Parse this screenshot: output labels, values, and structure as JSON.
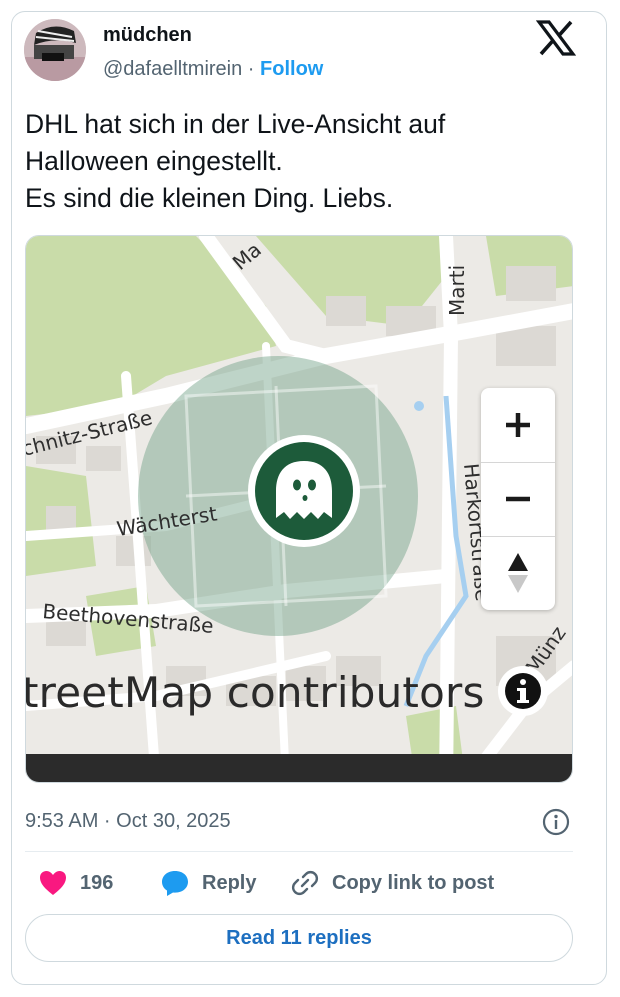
{
  "user": {
    "display_name": "müdchen",
    "handle": "@dafaelltmirein",
    "separator": " · ",
    "follow_label": "Follow"
  },
  "tweet": {
    "lines": [
      "DHL hat sich in der Live-Ansicht auf",
      "Halloween eingestellt.",
      "Es sind die kleinen Ding. Liebs."
    ]
  },
  "map": {
    "street_labels": {
      "s1": "chnitz-Straße",
      "s2": "Wächterst",
      "s3": "Beethovenstraße",
      "s4": "Harkortstraße",
      "s5": "Marti",
      "s6": "Ma",
      "s7": "Münz"
    },
    "attribution": "treetMap contributors",
    "zoom_in": "+",
    "zoom_out": "−",
    "marker_icon": "ghost-icon",
    "colors": {
      "park": "#c9dca9",
      "zone": "#6f9f86",
      "marker": "#1d5b3a",
      "water": "#a6cff0"
    }
  },
  "meta": {
    "timestamp": "9:53 AM · Oct 30, 2025"
  },
  "actions": {
    "likes": "196",
    "reply_label": "Reply",
    "copy_label": "Copy link to post",
    "read_replies_label": "Read 11 replies"
  },
  "colors": {
    "like": "#f91880",
    "reply": "#1d9bf0",
    "link": "#1d9bf0"
  }
}
